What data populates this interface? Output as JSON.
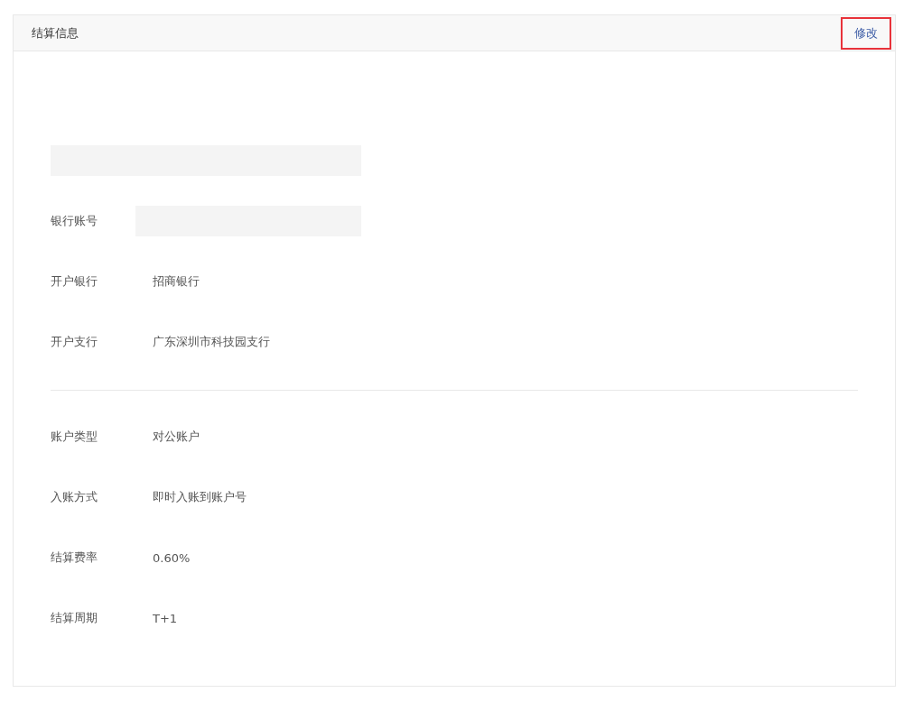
{
  "panel": {
    "title": "结算信息",
    "edit_link": {
      "label": "修改",
      "highlighted": true
    }
  },
  "sections": [
    {
      "rows": [
        {
          "kind": "redacted"
        },
        {
          "kind": "redacted",
          "label": "银行账号"
        },
        {
          "kind": "text",
          "label": "开户银行",
          "value": "招商银行"
        },
        {
          "kind": "text",
          "label": "开户支行",
          "value": "广东深圳市科技园支行"
        }
      ]
    },
    {
      "rows": [
        {
          "kind": "text",
          "label": "账户类型",
          "value": "对公账户"
        },
        {
          "kind": "text",
          "label": "入账方式",
          "value": "即时入账到账户号"
        },
        {
          "kind": "text",
          "label": "结算费率",
          "value": "0.60%"
        },
        {
          "kind": "text",
          "label": "结算周期",
          "value": "T+1"
        }
      ]
    }
  ]
}
